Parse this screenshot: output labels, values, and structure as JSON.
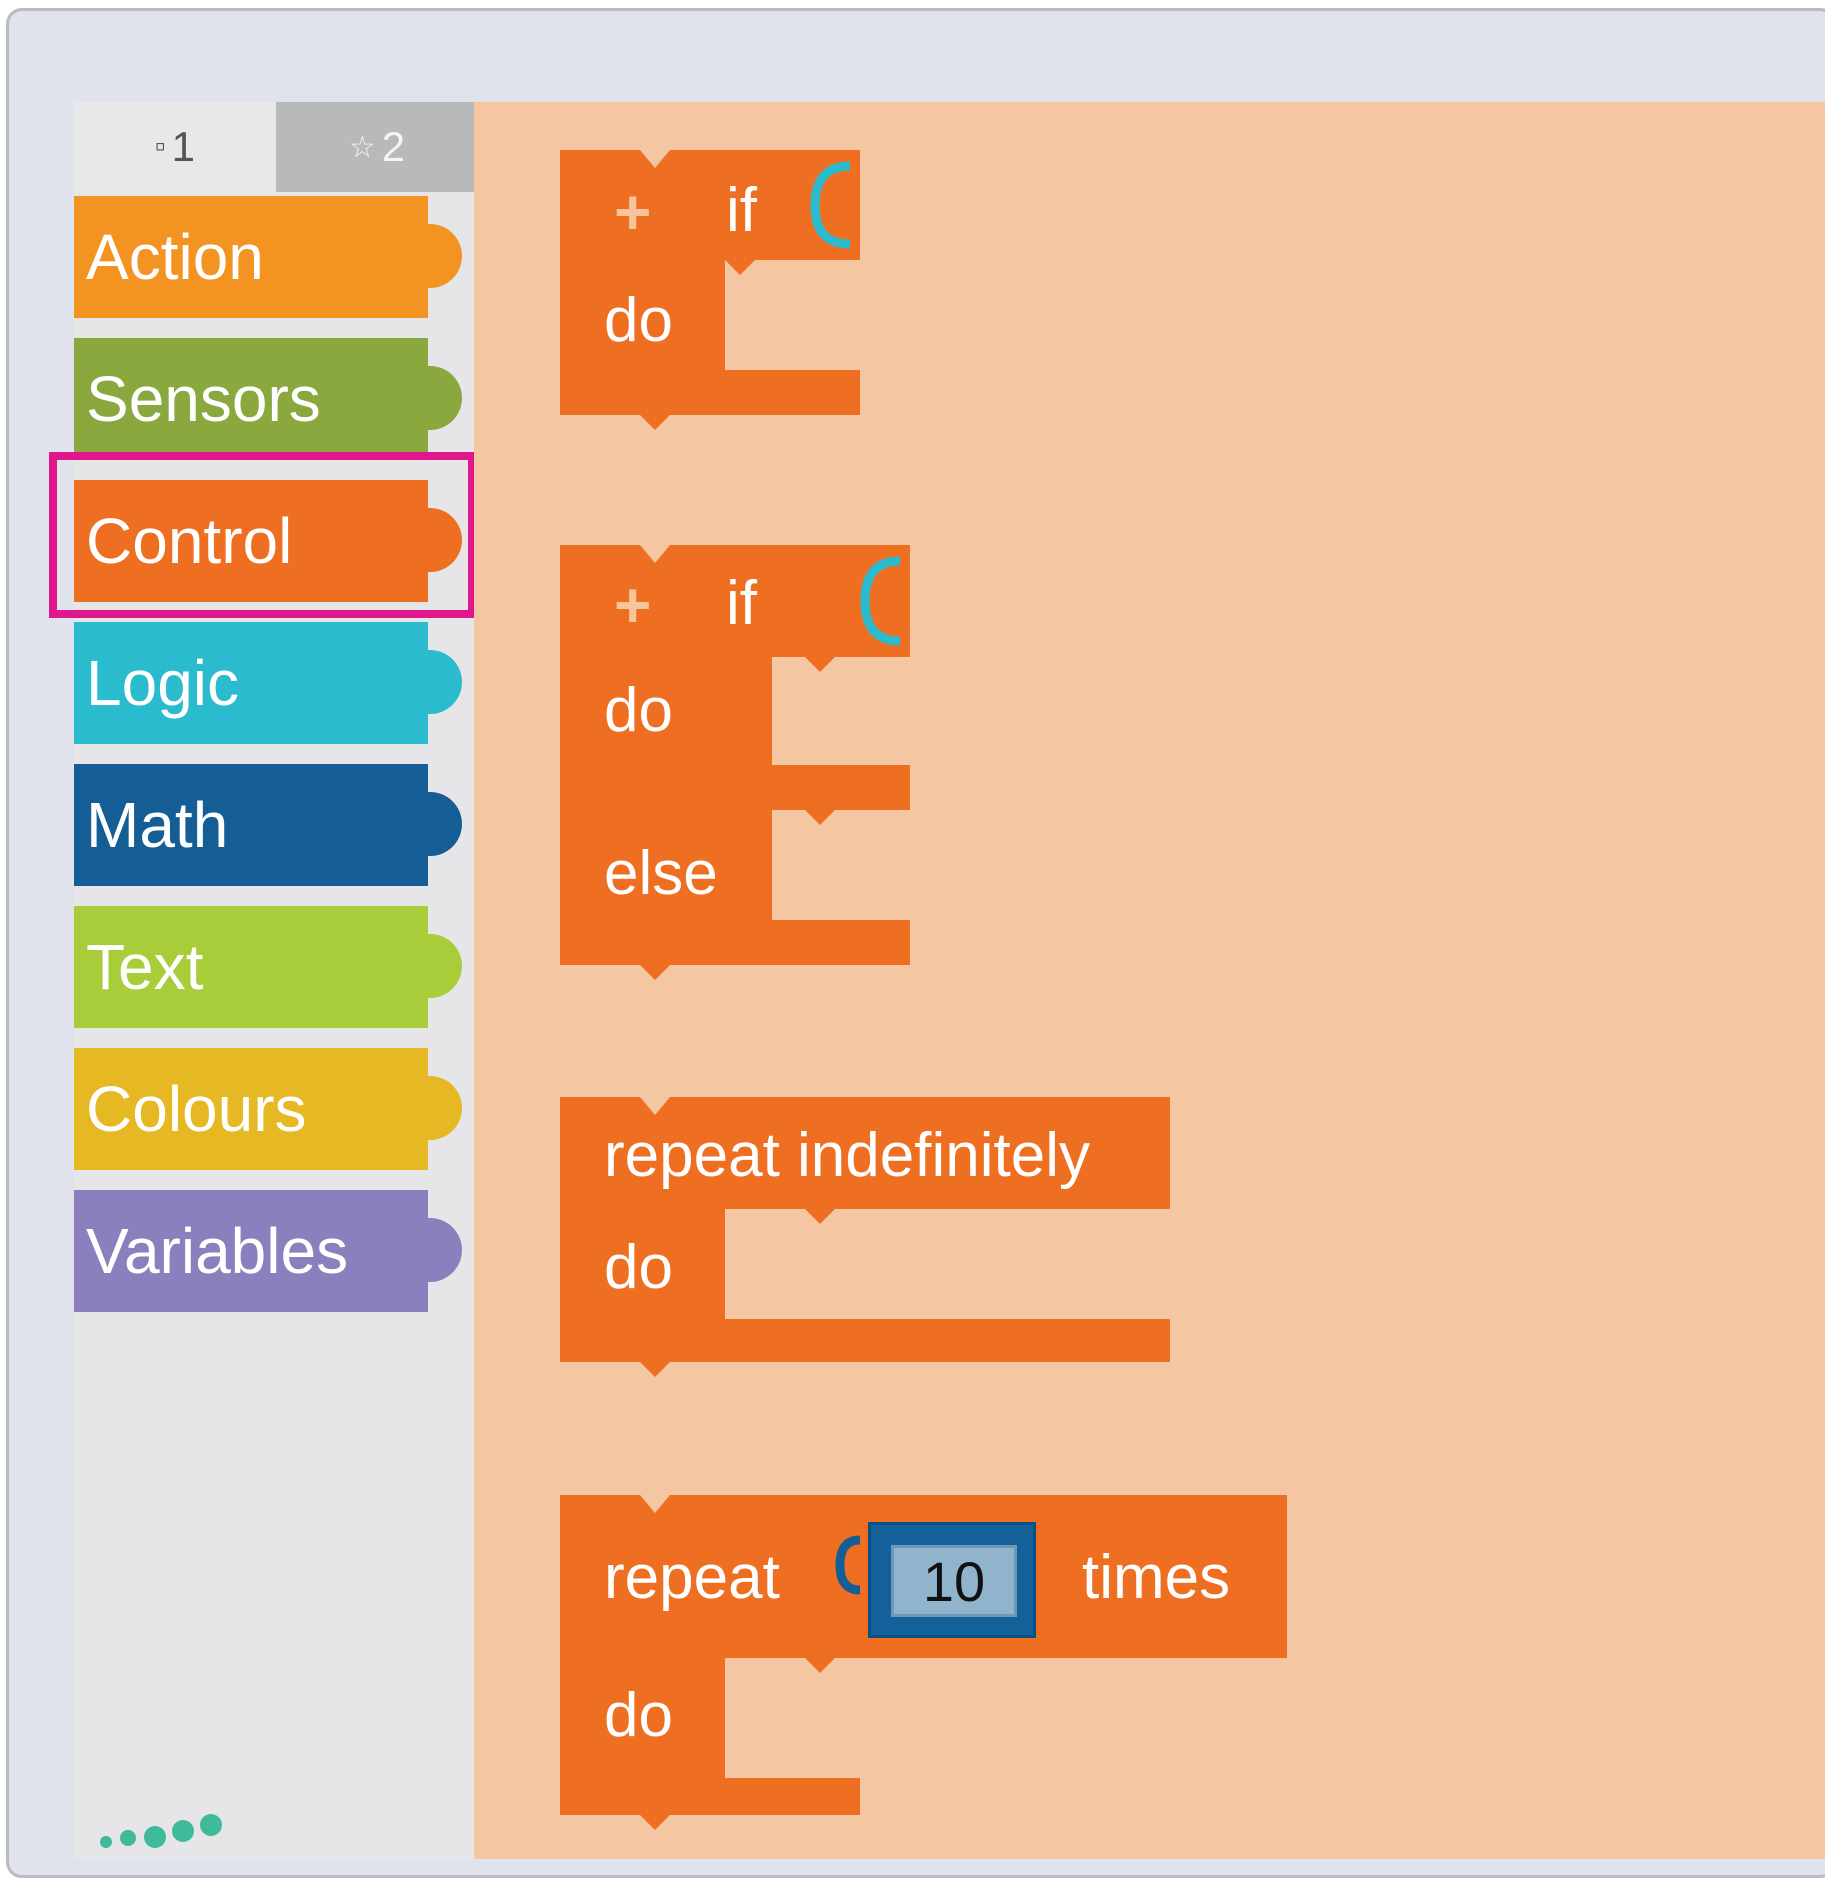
{
  "toolbox": {
    "tabs": [
      {
        "icon": "square-icon",
        "glyph": "▫",
        "label": "1"
      },
      {
        "icon": "star-icon",
        "glyph": "☆",
        "label": "2"
      }
    ],
    "categories": [
      {
        "label": "Action",
        "color": "#f39422"
      },
      {
        "label": "Sensors",
        "color": "#8aa83e"
      },
      {
        "label": "Control",
        "color": "#ef6f22",
        "selected": true
      },
      {
        "label": "Logic",
        "color": "#2bbbcf"
      },
      {
        "label": "Math",
        "color": "#145d95"
      },
      {
        "label": "Text",
        "color": "#a9cc3a"
      },
      {
        "label": "Colours",
        "color": "#e6b823"
      },
      {
        "label": "Variables",
        "color": "#8b80bd"
      }
    ]
  },
  "blocks": {
    "if_do": {
      "plus": "+",
      "if": "if",
      "do": "do"
    },
    "if_do_else": {
      "plus": "+",
      "if": "if",
      "do": "do",
      "else": "else"
    },
    "repeat_forever": {
      "label": "repeat indefinitely",
      "do": "do"
    },
    "repeat_times": {
      "repeat": "repeat",
      "count": "10",
      "times": "times",
      "do": "do"
    }
  },
  "colors": {
    "control_block": "#ef6f22",
    "workspace": "#f4c6a2",
    "highlight": "#e0168c",
    "logic_socket": "#2bbbcf",
    "math_socket": "#145d95"
  }
}
